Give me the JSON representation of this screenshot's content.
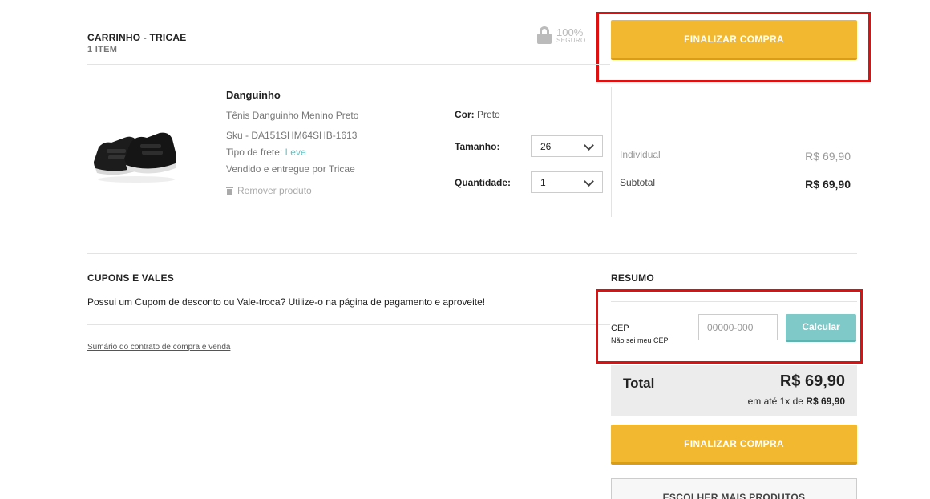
{
  "cart": {
    "title": "CARRINHO - TRICAE",
    "count": "1 ITEM",
    "secure_pct": "100%",
    "secure_label": "SEGURO",
    "checkout_label": "FINALIZAR COMPRA"
  },
  "product": {
    "image_icon": "sneaker-product-image",
    "brand": "Danguinho",
    "name": "Tênis Danguinho Menino Preto",
    "sku": "Sku - DA151SHM64SHB-1613",
    "shipping_label": "Tipo de frete: ",
    "shipping_value": "Leve",
    "sold_by": "Vendido e entregue por Tricae",
    "remove_label": "Remover produto",
    "color_label": "Cor:",
    "color_value": "Preto",
    "size_label": "Tamanho:",
    "size_value": "26",
    "qty_label": "Quantidade:",
    "qty_value": "1",
    "unit_label": "Individual",
    "unit_price": "R$ 69,90",
    "subtotal_label": "Subtotal",
    "subtotal_price": "R$ 69,90"
  },
  "coupons": {
    "title": "CUPONS E VALES",
    "text": "Possui um Cupom de desconto ou Vale-troca? Utilize-o na página de pagamento e aproveite!",
    "contract_link": "Sumário do contrato de compra e venda"
  },
  "summary": {
    "title": "RESUMO",
    "cep_label": "CEP",
    "cep_link": "Não sei meu CEP",
    "cep_placeholder": "00000-000",
    "calc_label": "Calcular",
    "total_label": "Total",
    "total_value": "R$ 69,90",
    "installment_prefix": "em até 1x de ",
    "installment_value": "R$ 69,90",
    "checkout_label": "FINALIZAR COMPRA",
    "more_label": "ESCOLHER MAIS PRODUTOS"
  },
  "colors": {
    "accent_yellow": "#f2b930",
    "accent_teal": "#7fcac8",
    "annotation_red": "#e01010"
  }
}
